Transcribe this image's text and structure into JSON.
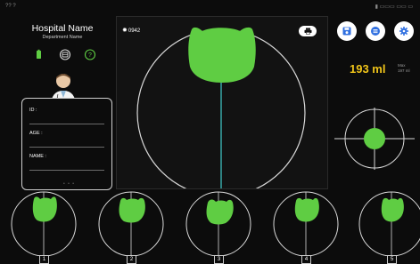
{
  "statusbar": {
    "left": "?? ?",
    "right": "▮ ▭▭▭ ▭▭ ▭"
  },
  "header": {
    "hospital_name": "Hospital Name",
    "department_name": "Department Name"
  },
  "status_icons": [
    "battery-icon",
    "scan-icon",
    "help-icon"
  ],
  "patient": {
    "id_label": "ID :",
    "age_label": "AGE :",
    "name_label": "NAME :",
    "ellipsis": "• • •"
  },
  "main": {
    "frame_count": "0942",
    "print_icon": "printer-icon"
  },
  "actions": [
    "save-icon",
    "list-icon",
    "settings-icon"
  ],
  "volume": {
    "value": "193 ml",
    "aux_line1": "Max",
    "aux_line2": "197 ml"
  },
  "thumbnails": [
    {
      "label": "1"
    },
    {
      "label": "2"
    },
    {
      "label": "3"
    },
    {
      "label": "4"
    },
    {
      "label": "5"
    }
  ],
  "colors": {
    "accent": "#5fcd43",
    "volume": "#f0c419",
    "cyan_line": "#3fbfbf",
    "background": "#0c0c0c"
  }
}
